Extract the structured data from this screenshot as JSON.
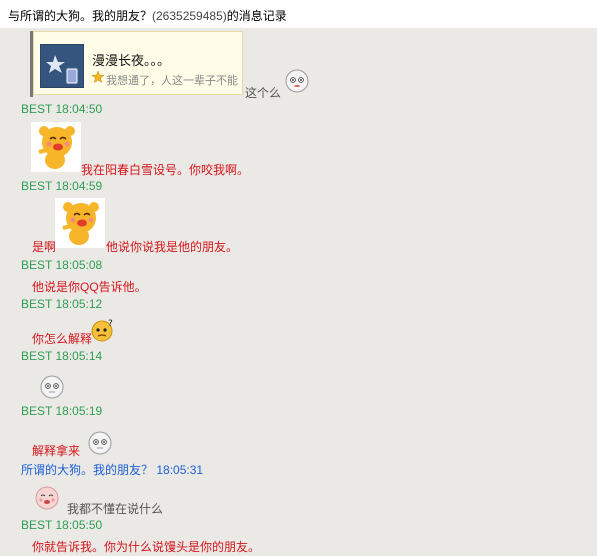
{
  "window": {
    "title_prefix": "与所谓的大狗。我的朋友？",
    "title_qq": "(2635259485)",
    "title_suffix": "的消息记录"
  },
  "card": {
    "title": "漫漫长夜。。。",
    "subtitle": "我想通了，人这一辈子不能",
    "trailing_text": "这个么"
  },
  "messages": [
    {
      "sender": "BEST",
      "time": "18:04:50",
      "text": "我在阳春白雪设号。你咬我啊。",
      "sticker": "yellow-bear"
    },
    {
      "sender": "BEST",
      "time": "18:04:59",
      "text_before": "是啊",
      "text": "他说你说我是他的朋友。",
      "sticker": "yellow-bear"
    },
    {
      "sender": "BEST",
      "time": "18:05:08",
      "text": "他说是你QQ告诉他。"
    },
    {
      "sender": "BEST",
      "time": "18:05:12",
      "text": "你怎么解释",
      "sticker": "confused-face"
    },
    {
      "sender": "BEST",
      "time": "18:05:14",
      "sticker": "blank-face"
    },
    {
      "sender": "BEST",
      "time": "18:05:19",
      "text": "解释拿来",
      "sticker": "blank-face"
    },
    {
      "sender": "所谓的大狗。我的朋友？",
      "time": "18:05:31",
      "text": "我都不懂在说什么",
      "sticker": "pink-face"
    },
    {
      "sender": "BEST",
      "time": "18:05:50",
      "text": "你就告诉我。你为什么说馒头是你的朋友。"
    }
  ],
  "colors": {
    "best": "#2e9e52",
    "peer": "#1c5fd6",
    "message_red": "#d4151b"
  }
}
